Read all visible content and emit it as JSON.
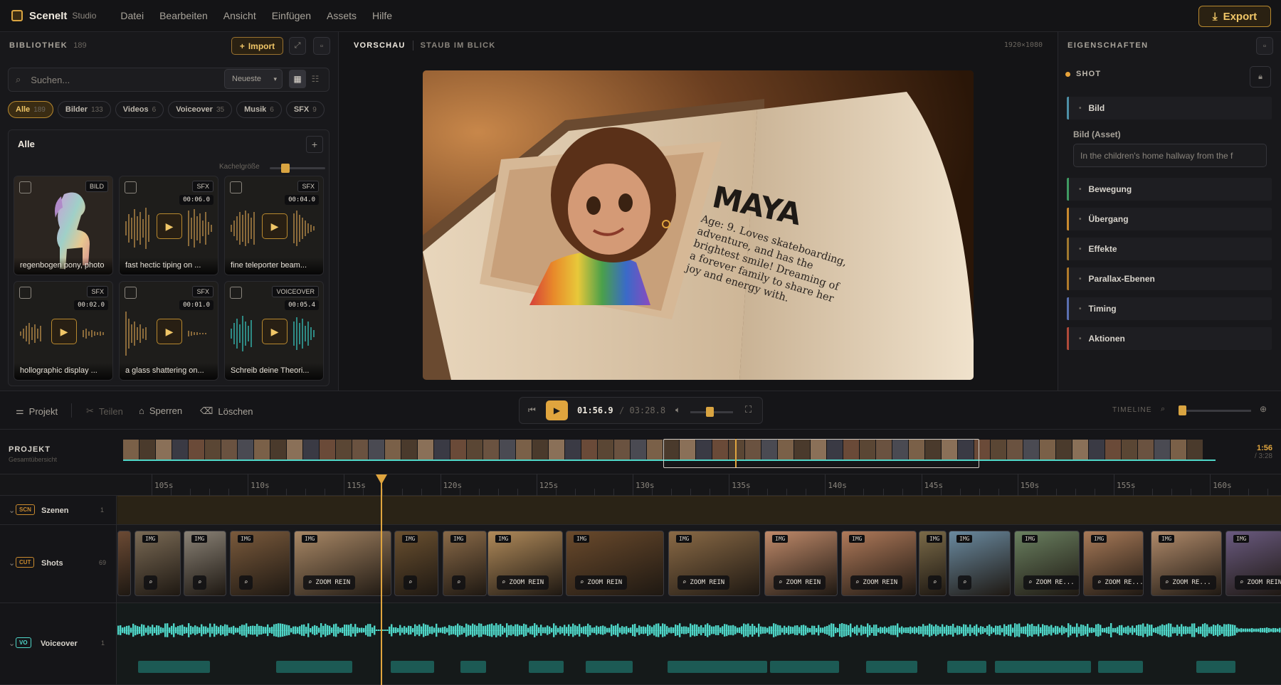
{
  "app": {
    "name": "SceneIt",
    "edition": "Studio",
    "export_label": "Export"
  },
  "menu": [
    "Datei",
    "Bearbeiten",
    "Ansicht",
    "Einfügen",
    "Assets",
    "Hilfe"
  ],
  "library": {
    "title": "BIBLIOTHEK",
    "count": "189",
    "import_label": "Import",
    "search_placeholder": "Suchen...",
    "sort": "Neueste",
    "filters": [
      {
        "label": "Alle",
        "count": "189"
      },
      {
        "label": "Bilder",
        "count": "133"
      },
      {
        "label": "Videos",
        "count": "6"
      },
      {
        "label": "Voiceover",
        "count": "35"
      },
      {
        "label": "Musik",
        "count": "6"
      },
      {
        "label": "SFX",
        "count": "9"
      }
    ],
    "group_title": "Alle",
    "tile_size_label": "Kachelgröße",
    "tiles": [
      {
        "type": "BILD",
        "duration": "",
        "label": "regenbogen pony, photo"
      },
      {
        "type": "SFX",
        "duration": "00:06.0",
        "label": "fast hectic tiping on ..."
      },
      {
        "type": "SFX",
        "duration": "00:04.0",
        "label": "fine teleporter beam..."
      },
      {
        "type": "SFX",
        "duration": "00:02.0",
        "label": "hollographic display ..."
      },
      {
        "type": "SFX",
        "duration": "00:01.0",
        "label": "a glass shattering on..."
      },
      {
        "type": "VOICEOVER",
        "duration": "00:05.4",
        "label": "Schreib deine Theori..."
      }
    ]
  },
  "preview": {
    "label": "VORSCHAU",
    "scene": "STAUB IM BLICK",
    "resolution": "1920×1080",
    "book_title": "MAYA",
    "book_text": [
      "Age: 9. Loves skateboarding,",
      "adventure, and has the",
      "brightest smile! Dreaming of",
      "a forever family to share her",
      "joy and energy with."
    ]
  },
  "properties": {
    "title": "EIGENSCHAFTEN",
    "shot_label": "SHOT",
    "sections": [
      {
        "label": "Bild",
        "color": "#4d8fa6"
      },
      {
        "label": "Bewegung",
        "color": "#3f9a62"
      },
      {
        "label": "Übergang",
        "color": "#c98a2e"
      },
      {
        "label": "Effekte",
        "color": "#a0782e"
      },
      {
        "label": "Parallax-Ebenen",
        "color": "#b07a2a"
      },
      {
        "label": "Timing",
        "color": "#5a6fb0"
      },
      {
        "label": "Aktionen",
        "color": "#b04a3a"
      }
    ],
    "asset_label": "Bild (Asset)",
    "asset_value": "In the children's home hallway from the f"
  },
  "controls": {
    "projekt": "Projekt",
    "teilen": "Teilen",
    "sperren": "Sperren",
    "loeschen": "Löschen",
    "current_time": "01:56.9",
    "separator": "/",
    "total_time": "03:28.8",
    "timeline_label": "TIMELINE",
    "volume": 0.45,
    "zoom": 0.0
  },
  "overview": {
    "title": "PROJEKT",
    "subtitle": "Gesamtübersicht",
    "time": "1:56",
    "total": "/ 3:28"
  },
  "ruler": [
    "105s",
    "110s",
    "115s",
    "120s",
    "125s",
    "130s",
    "135s",
    "140s",
    "145s",
    "150s",
    "155s",
    "160s"
  ],
  "tracks": [
    {
      "tag": "SCN",
      "name": "Szenen",
      "count": "1",
      "color": "#c98a2e"
    },
    {
      "tag": "CUT",
      "name": "Shots",
      "count": "69",
      "color": "#c98a2e"
    },
    {
      "tag": "VO",
      "name": "Voiceover",
      "count": "1",
      "color": "#4fd6c8"
    }
  ],
  "shots": [
    {
      "label": "",
      "badge": "",
      "color": "#6b4a34"
    },
    {
      "label": "",
      "badge": "IMG",
      "color": "#7a6a55"
    },
    {
      "label": "",
      "badge": "IMG",
      "color": "#8a8276"
    },
    {
      "label": "",
      "badge": "IMG",
      "color": "#7a5a3c"
    },
    {
      "label": "ZOOM REIN",
      "badge": "IMG",
      "color": "#a98866"
    },
    {
      "label": "",
      "badge": "IMG",
      "color": "#6a5030"
    },
    {
      "label": "",
      "badge": "IMG",
      "color": "#8a6a48"
    },
    {
      "label": "ZOOM REIN",
      "badge": "IMG",
      "color": "#b08a5a"
    },
    {
      "label": "ZOOM REIN",
      "badge": "IMG",
      "color": "#6a4a2c"
    },
    {
      "label": "ZOOM REIN",
      "badge": "IMG",
      "color": "#8a6a46"
    },
    {
      "label": "ZOOM REIN",
      "badge": "IMG",
      "color": "#c08a6a"
    },
    {
      "label": "ZOOM REIN",
      "badge": "IMG",
      "color": "#b07a5a"
    },
    {
      "label": "",
      "badge": "IMG",
      "color": "#7a6a48"
    },
    {
      "label": "",
      "badge": "IMG",
      "color": "#6a8aa0"
    },
    {
      "label": "ZOOM RE...",
      "badge": "IMG",
      "color": "#6a8060"
    },
    {
      "label": "ZOOM RE...",
      "badge": "IMG",
      "color": "#a87a58"
    },
    {
      "label": "ZOOM RE...",
      "badge": "IMG",
      "color": "#b08a6a"
    },
    {
      "label": "ZOOM REIN",
      "badge": "IMG",
      "color": "#6a5a80"
    }
  ],
  "colors": {
    "accent": "#e0a53e",
    "teal": "#4fd6c8"
  }
}
